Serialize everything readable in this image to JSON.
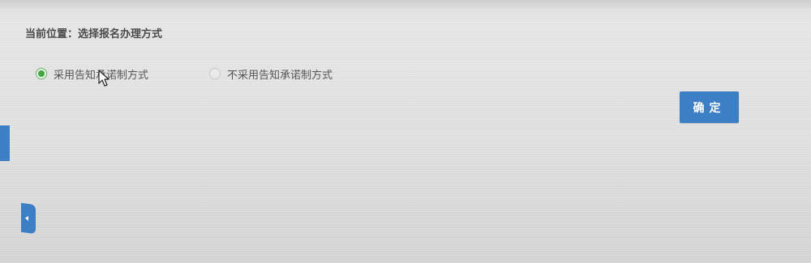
{
  "breadcrumb": {
    "text": "当前位置：选择报名办理方式"
  },
  "options": [
    {
      "label": "采用告知承诺制方式",
      "checked": true
    },
    {
      "label": "不采用告知承诺制方式",
      "checked": false
    }
  ],
  "confirm_button": {
    "label": "确定"
  },
  "icons": {
    "collapse_toggle": "chevron-left-icon",
    "cursor": "mouse-pointer-icon"
  },
  "colors": {
    "accent": "#3d7fc4",
    "radio_checked": "#3ea83e"
  }
}
